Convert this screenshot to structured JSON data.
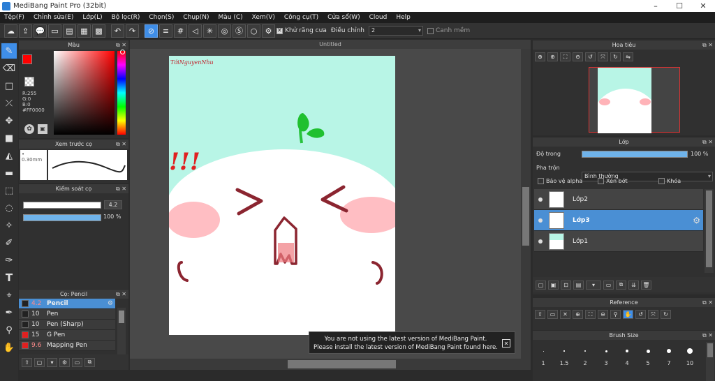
{
  "window": {
    "title": "MediBang Paint Pro (32bit)",
    "minimize": "–",
    "maximize": "☐",
    "close": "✕"
  },
  "menu": [
    "Tệp(F)",
    "Chỉnh sửa(E)",
    "Lớp(L)",
    "Bộ lọc(R)",
    "Chọn(S)",
    "Chụp(N)",
    "Màu (C)",
    "Xem(V)",
    "Công cụ(T)",
    "Cửa sổ(W)",
    "Cloud",
    "Help"
  ],
  "toolbar": {
    "antialias_label": "Khử răng cưa",
    "adjust_label": "Điều chỉnh",
    "adjust_value": "2",
    "margin_label": "Canh mềm"
  },
  "color_panel": {
    "title": "Màu",
    "r": "R:255",
    "g": "G:0",
    "b": "B:0",
    "hex": "#FF0000",
    "fg_color": "#ff0000"
  },
  "brush_preview": {
    "title": "Xem trước cọ",
    "size": "0.30mm"
  },
  "brush_control": {
    "title": "Kiểm soát cọ",
    "size": "4.2",
    "opacity": "100 %",
    "size_fraction": 0.95,
    "opacity_fraction": 1.0
  },
  "brush_list": {
    "title": "Cọ: Pencil",
    "items": [
      {
        "size": "4.2",
        "name": "Pencil",
        "color": "#222222"
      },
      {
        "size": "10",
        "name": "Pen",
        "color": "#222222"
      },
      {
        "size": "10",
        "name": "Pen (Sharp)",
        "color": "#222222"
      },
      {
        "size": "15",
        "name": "G Pen",
        "color": "#e02020"
      },
      {
        "size": "9.6",
        "name": "Mapping Pen",
        "color": "#e02020"
      }
    ]
  },
  "document": {
    "tab": "Untitled"
  },
  "canvas_art": {
    "signature": "TớiNguyenNhu",
    "exclaim": "!!!",
    "bg_color": "#b8f5e6"
  },
  "notification": {
    "line1": "You are not using the latest version of MediBang Paint.",
    "line2": "Please install the latest version of MediBang Paint found here.",
    "close": "✕"
  },
  "navigator": {
    "title": "Hoa tiêu"
  },
  "layers": {
    "title": "Lớp",
    "opacity_label": "Độ trong",
    "opacity_value": "100 %",
    "opacity_fraction": 1.0,
    "blend_label": "Pha trộn",
    "blend_value": "Bình thường",
    "protect_alpha": "Bảo vệ alpha",
    "clipping": "Xén bớt",
    "lock": "Khóa",
    "items": [
      {
        "name": "Lớp2",
        "selected": false
      },
      {
        "name": "Lớp3",
        "selected": true
      },
      {
        "name": "Lớp1",
        "selected": false
      }
    ]
  },
  "reference": {
    "title": "Reference"
  },
  "brush_size": {
    "title": "Brush Size",
    "sizes": [
      "1",
      "1.5",
      "2",
      "3",
      "4",
      "5",
      "7",
      "10"
    ]
  }
}
